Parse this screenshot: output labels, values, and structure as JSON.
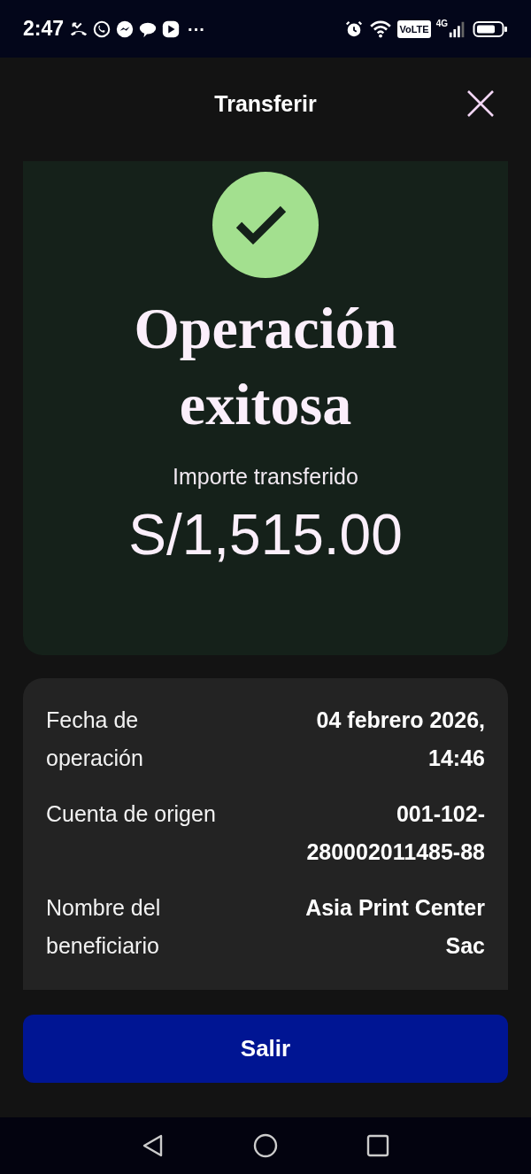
{
  "status_bar": {
    "time": "2:47",
    "more": "···",
    "volte": "VoLTE",
    "network": "4G"
  },
  "header": {
    "title": "Transferir"
  },
  "result": {
    "title": "Operación exitosa",
    "amount_label": "Importe transferido",
    "amount": "S/1,515.00"
  },
  "details": [
    {
      "label": "Fecha de operación",
      "value": "04 febrero 2026, 14:46"
    },
    {
      "label": "Cuenta de origen",
      "value": "001-102-280002011485-88"
    },
    {
      "label": "Nombre del beneficiario",
      "value": "Asia Print Center Sac"
    }
  ],
  "button": {
    "label": "Salir"
  }
}
